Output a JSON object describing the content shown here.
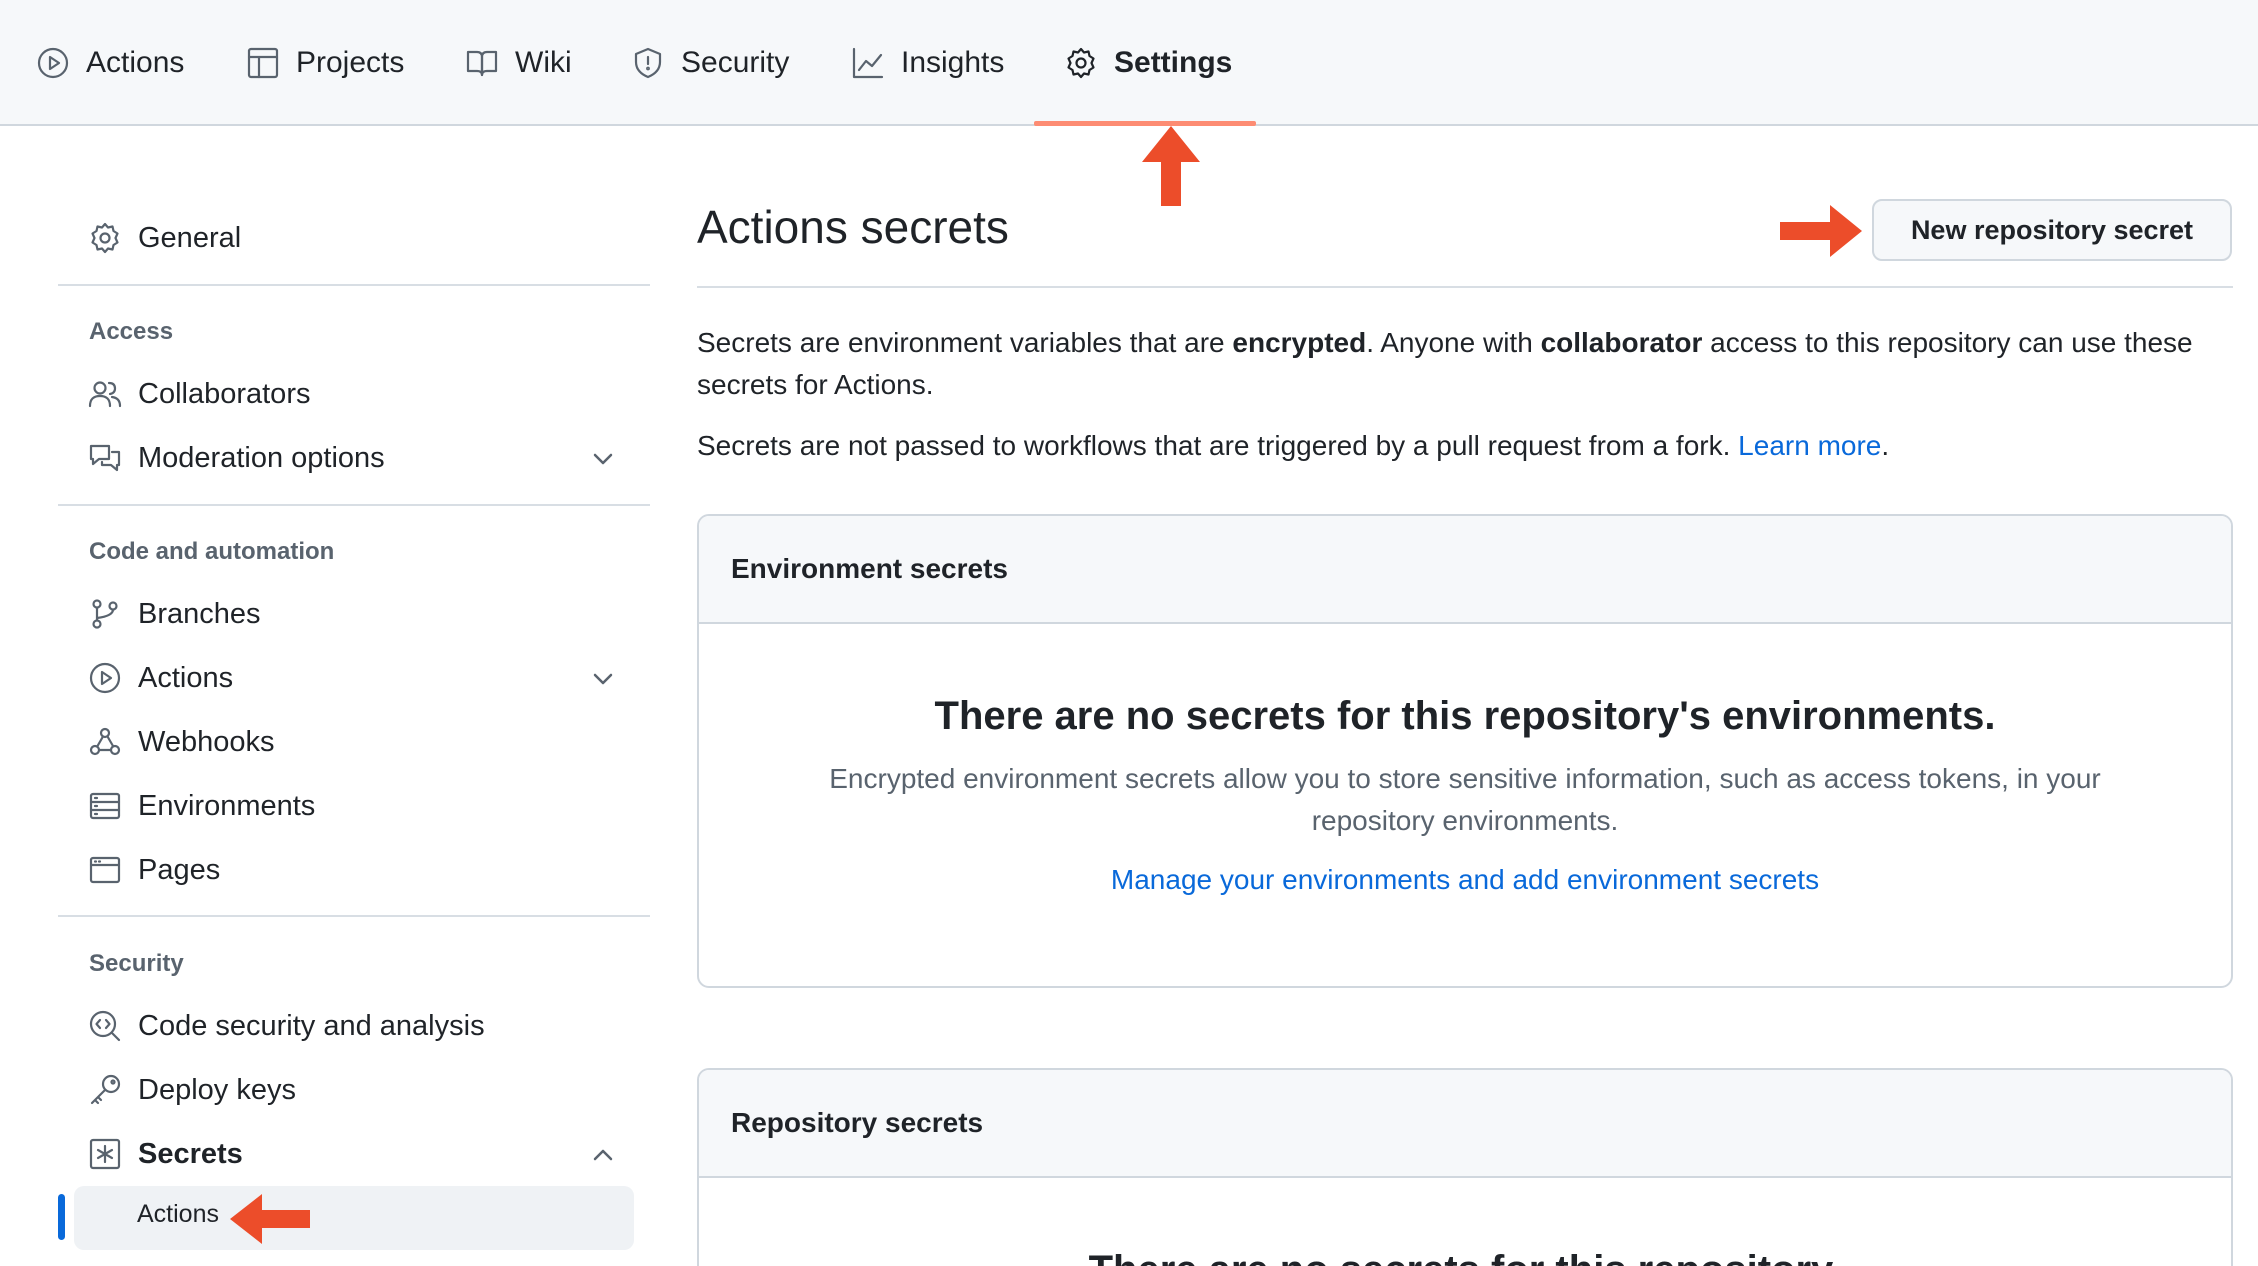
{
  "colors": {
    "accent_underline": "#fd8c73",
    "link": "#0969da",
    "annotation_arrow": "#ec4d2a",
    "active_bar": "#0969da"
  },
  "tabs": [
    {
      "label": "Actions",
      "icon": "play-circle-icon"
    },
    {
      "label": "Projects",
      "icon": "table-icon"
    },
    {
      "label": "Wiki",
      "icon": "book-icon"
    },
    {
      "label": "Security",
      "icon": "shield-icon"
    },
    {
      "label": "Insights",
      "icon": "graph-icon"
    },
    {
      "label": "Settings",
      "icon": "gear-icon",
      "active": true
    }
  ],
  "sidebar": {
    "general": {
      "label": "General",
      "icon": "gear-icon"
    },
    "sections": [
      {
        "heading": "Access",
        "items": [
          {
            "label": "Collaborators",
            "icon": "people-icon"
          },
          {
            "label": "Moderation options",
            "icon": "comment-discussion-icon",
            "expandable": true
          }
        ]
      },
      {
        "heading": "Code and automation",
        "items": [
          {
            "label": "Branches",
            "icon": "git-branch-icon"
          },
          {
            "label": "Actions",
            "icon": "play-circle-icon",
            "expandable": true
          },
          {
            "label": "Webhooks",
            "icon": "webhook-icon"
          },
          {
            "label": "Environments",
            "icon": "server-icon"
          },
          {
            "label": "Pages",
            "icon": "browser-icon"
          }
        ]
      },
      {
        "heading": "Security",
        "items": [
          {
            "label": "Code security and analysis",
            "icon": "codescan-icon"
          },
          {
            "label": "Deploy keys",
            "icon": "key-icon"
          },
          {
            "label": "Secrets",
            "icon": "asterisk-icon",
            "expanded": true,
            "bold": true
          }
        ]
      }
    ],
    "secrets_sub_items": [
      {
        "label": "Actions",
        "active": true
      }
    ]
  },
  "main": {
    "title": "Actions secrets",
    "new_button": "New repository secret",
    "desc1": {
      "part1": "Secrets are environment variables that are ",
      "bold1": "encrypted",
      "part2": ". Anyone with ",
      "bold2": "collaborator",
      "part3": " access to this repository can use these secrets for Actions."
    },
    "desc2": {
      "text": "Secrets are not passed to workflows that are triggered by a pull request from a fork. ",
      "link": "Learn more",
      "end": "."
    },
    "env_box": {
      "header": "Environment secrets",
      "blank_title": "There are no secrets for this repository's environments.",
      "blank_desc": "Encrypted environment secrets allow you to store sensitive information, such as access tokens, in your repository environments.",
      "blank_link": "Manage your environments and add environment secrets"
    },
    "repo_box": {
      "header": "Repository secrets",
      "blank_title": "There are no secrets for this repository."
    }
  }
}
